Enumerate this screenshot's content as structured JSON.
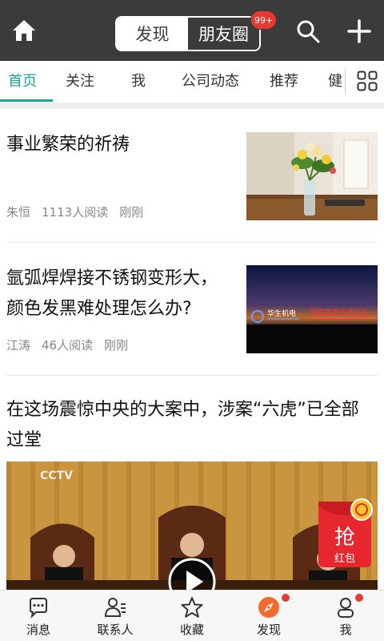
{
  "header": {
    "segment_discover": "发现",
    "segment_friends": "朋友圈",
    "badge_count": "99+"
  },
  "tabs": [
    {
      "label": "首页",
      "active": true
    },
    {
      "label": "关注",
      "active": false
    },
    {
      "label": "我",
      "active": false
    },
    {
      "label": "公司动态",
      "active": false
    },
    {
      "label": "推荐",
      "active": false
    },
    {
      "label": "健",
      "active": false
    }
  ],
  "articles": [
    {
      "title": "事业繁荣的祈祷",
      "author": "朱恒",
      "reads": "1113人阅读",
      "time": "刚刚",
      "thumb": "flower-vase"
    },
    {
      "title_line1": "氩弧焊焊接不锈钢变形大，",
      "title_line2": "颜色发黑难处理怎么办?",
      "author": "江涛",
      "reads": "46人阅读",
      "time": "刚刚",
      "thumb": "night-building",
      "sign_left": "华生机电",
      "sign_right": "国家高新技术企业"
    },
    {
      "title_line1": "在这场震惊中央的大案中，涉案“六虎”已全部",
      "title_line2": "过堂",
      "video_logo": "CCTV"
    }
  ],
  "redpack": {
    "char": "抢",
    "label": "红包"
  },
  "bottom_nav": [
    {
      "label": "消息",
      "icon": "chat-bubble-icon"
    },
    {
      "label": "联系人",
      "icon": "contacts-icon"
    },
    {
      "label": "收藏",
      "icon": "star-icon"
    },
    {
      "label": "发现",
      "icon": "compass-icon",
      "active": true
    },
    {
      "label": "我",
      "icon": "person-icon",
      "dot": true
    }
  ],
  "colors": {
    "header_bg": "#3b3b3b",
    "accent": "#19a59c",
    "badge": "#e53935",
    "discover_orange": "#f26a2e"
  }
}
